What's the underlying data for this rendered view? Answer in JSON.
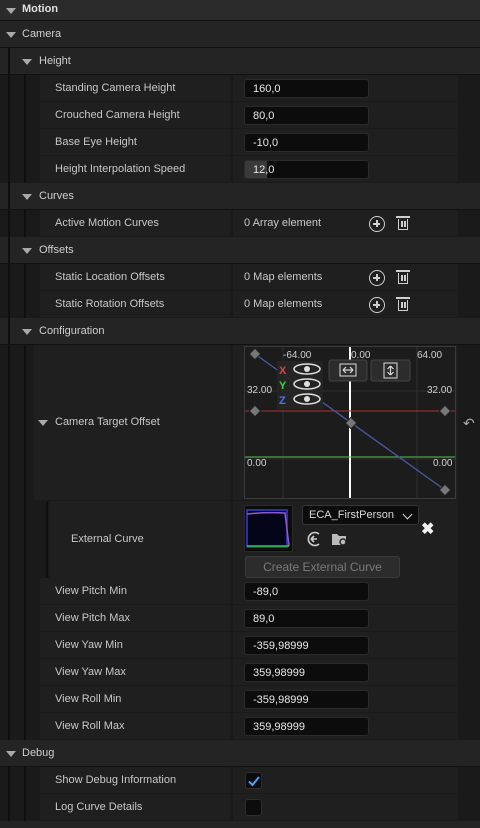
{
  "sections": {
    "motion": "Motion",
    "camera": "Camera",
    "height": "Height",
    "curves": "Curves",
    "offsets": "Offsets",
    "configuration": "Configuration",
    "debug": "Debug"
  },
  "height_props": [
    {
      "label": "Standing Camera Height",
      "value": "160,0"
    },
    {
      "label": "Crouched Camera Height",
      "value": "80,0"
    },
    {
      "label": "Base Eye Height",
      "value": "-10,0"
    },
    {
      "label": "Height Interpolation Speed",
      "value": "12,0"
    }
  ],
  "curves_props": [
    {
      "label": "Active Motion Curves",
      "value": "0 Array element"
    }
  ],
  "offsets_props": [
    {
      "label": "Static Location Offsets",
      "value": "0 Map elements"
    },
    {
      "label": "Static Rotation Offsets",
      "value": "0 Map elements"
    }
  ],
  "camera_target_offset": {
    "label": "Camera Target Offset",
    "axis_labels": {
      "top_left": "-64.00",
      "top_mid": "0.00",
      "top_right": "64.00",
      "mid_left": "32.00",
      "mid_right": "32.00",
      "bottom_left": "0.00",
      "bottom_right": "0.00"
    },
    "channels": [
      "X",
      "Y",
      "Z"
    ],
    "channel_colors": [
      "#e04040",
      "#40d040",
      "#4a70ff"
    ]
  },
  "external_curve": {
    "label": "External Curve",
    "asset_name": "ECA_FirstPerson",
    "create_button": "Create External Curve"
  },
  "view_props": [
    {
      "label": "View Pitch Min",
      "value": "-89,0"
    },
    {
      "label": "View Pitch Max",
      "value": "89,0"
    },
    {
      "label": "View Yaw Min",
      "value": "-359,98999"
    },
    {
      "label": "View Yaw Max",
      "value": "359,98999"
    },
    {
      "label": "View Roll Min",
      "value": "-359,98999"
    },
    {
      "label": "View Roll Max",
      "value": "359,98999"
    }
  ],
  "debug_props": [
    {
      "label": "Show Debug Information",
      "checked": true
    },
    {
      "label": "Log Curve Details",
      "checked": false
    }
  ]
}
